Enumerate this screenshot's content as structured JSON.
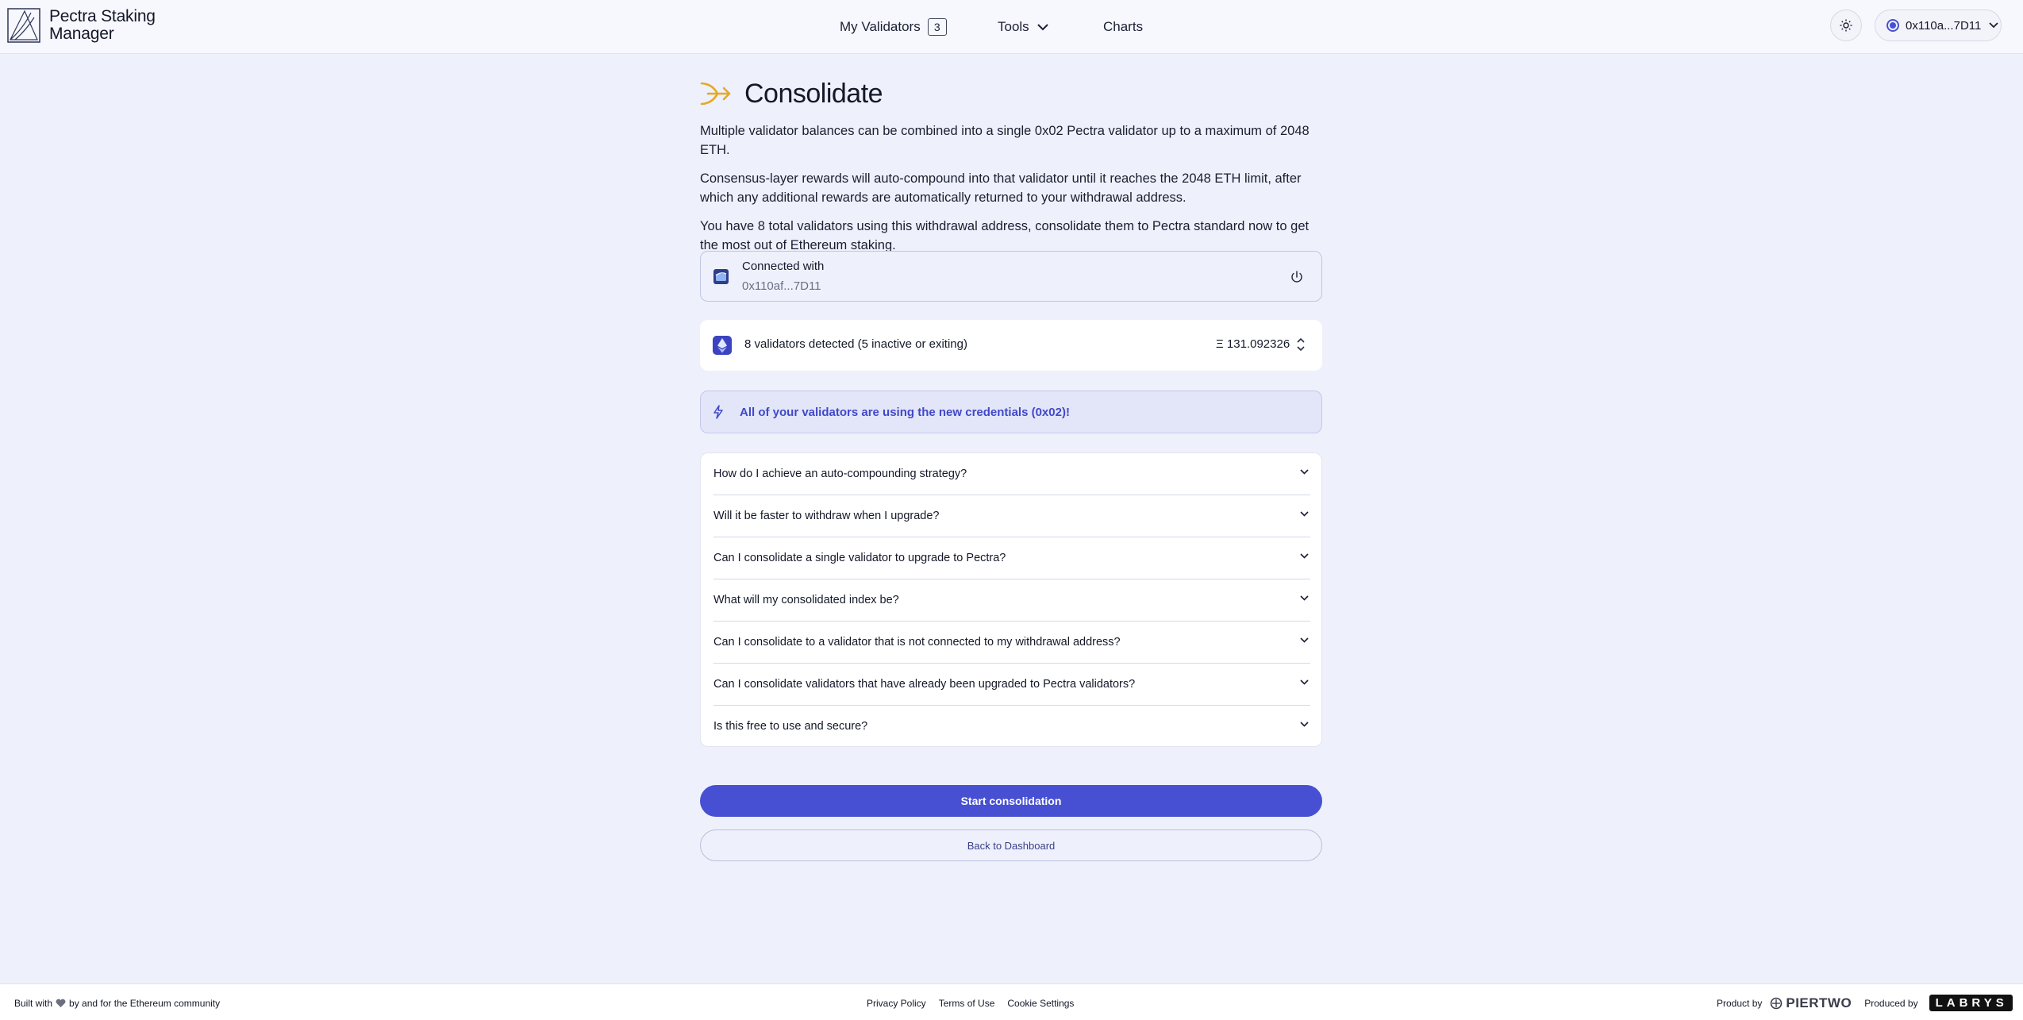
{
  "header": {
    "brand_line1": "Pectra Staking",
    "brand_line2": "Manager",
    "nav": {
      "validators_label": "My Validators",
      "validators_count": "3",
      "tools_label": "Tools",
      "charts_label": "Charts"
    },
    "account_label": "0x110a...7D11"
  },
  "main": {
    "title": "Consolidate",
    "paragraphs": [
      "Multiple validator balances can be combined into a single 0x02 Pectra validator up to a maximum of 2048 ETH.",
      "Consensus-layer rewards will auto-compound into that validator until it reaches the 2048 ETH limit, after which any additional rewards are automatically returned to your withdrawal address.",
      "You have 8 total validators using this withdrawal address, consolidate them to Pectra standard now to get the most out of Ethereum staking."
    ],
    "connected": {
      "label": "Connected with",
      "address": "0x110af...7D11"
    },
    "validators": {
      "summary": "8 validators detected (5 inactive or exiting)",
      "amount": "Ξ 131.092326"
    },
    "notice": "All of your validators are using the new credentials (0x02)!",
    "faq": [
      "How do I achieve an auto-compounding strategy?",
      "Will it be faster to withdraw when I upgrade?",
      "Can I consolidate a single validator to upgrade to Pectra?",
      "What will my consolidated index be?",
      "Can I consolidate to a validator that is not connected to my withdrawal address?",
      "Can I consolidate validators that have already been upgraded to Pectra validators?",
      "Is this free to use and secure?"
    ],
    "start_button": "Start consolidation",
    "back_button": "Back to Dashboard"
  },
  "footer": {
    "built_prefix": "Built with",
    "built_suffix": "by and for the Ethereum community",
    "links": [
      "Privacy Policy",
      "Terms of Use",
      "Cookie Settings"
    ],
    "product_by": "Product by",
    "piertwo": "PIERTWO",
    "produced_by": "Produced by",
    "labrys": "LABRYS"
  },
  "colors": {
    "accent": "#4750d2",
    "background": "#eef1fb",
    "notice_text": "#4049c8",
    "consolidate_icon": "#e6a82a"
  },
  "icons": [
    "pectra-logo-icon",
    "chevron-down-icon",
    "sun-icon",
    "account-status-icon",
    "consolidate-arrow-icon",
    "wallet-icon",
    "power-icon",
    "ethereum-icon",
    "expand-updown-icon",
    "bolt-icon",
    "heart-icon",
    "piertwo-logo-icon"
  ]
}
